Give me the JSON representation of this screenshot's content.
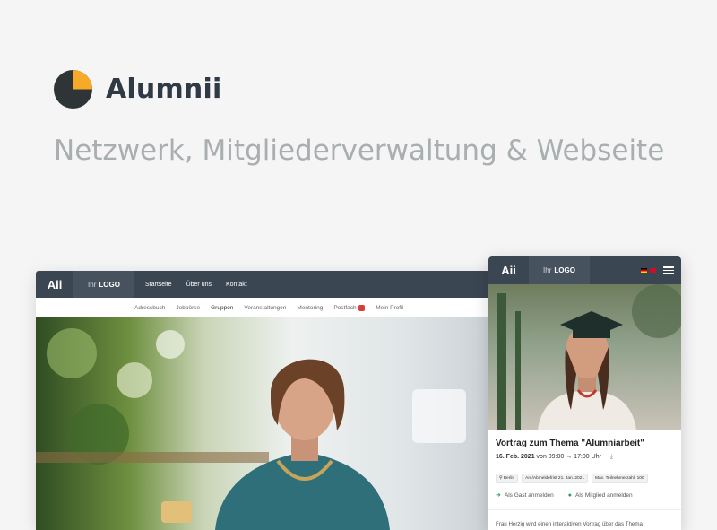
{
  "brand": {
    "name": "Alumnii",
    "tagline": "Netzwerk, Mitgliederverwaltung & Webseite"
  },
  "colors": {
    "dark": "#3a4652",
    "accent": "#f7a928",
    "green": "#2e9e68",
    "badge": "#e53935"
  },
  "desktop": {
    "logo": "Aii",
    "ihr": "Ihr",
    "logo_word": "LOGO",
    "top_nav": [
      "Startseite",
      "Über uns",
      "Kontakt"
    ],
    "sub_nav": [
      "Adressbuch",
      "Jobbörse",
      "Gruppen",
      "Veranstaltungen",
      "Mentoring",
      "Postfach",
      "Mein Profil"
    ],
    "postfach_badge": "1",
    "active_tab": "Gruppen"
  },
  "mobile": {
    "logo": "Aii",
    "ihr": "Ihr",
    "logo_word": "LOGO",
    "flags": [
      "german-flag-icon",
      "uk-flag-icon"
    ],
    "event": {
      "title": "Vortrag zum Thema \"Alumniarbeit\"",
      "date": "16. Feb. 2021",
      "time": "von 09:00 → 17:00 Uhr",
      "tags": [
        "Berlin",
        "An-/Abmeldefrist 21. Jan. 2021",
        "Max. Teilnehmerzahl: 100"
      ],
      "guest_label": "Als Gast anmelden",
      "member_label": "Als Mitglied anmelden",
      "description": "Frau Herzig wird einen interaktiven Vortrag über das Thema"
    }
  }
}
